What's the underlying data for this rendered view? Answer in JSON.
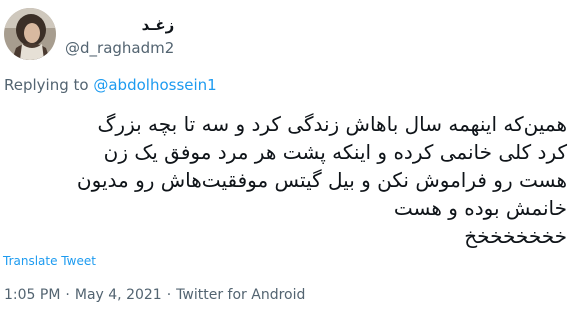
{
  "user": {
    "display_name": "زغـد",
    "handle": "@d_raghadm2",
    "avatar_icon": "profile-photo"
  },
  "reply": {
    "prefix": "Replying to",
    "mention": "@abdolhossein1"
  },
  "tweet": {
    "lines": [
      "همین‌که اینهمه سال باهاش زندگی کرد و سه تا بچه بزرگ",
      "کرد کلی خانمی کرده و اینکه پشت هر مرد موفق یک زن",
      "هست رو فراموش نکن و بیل گیتس موفقیت‌هاش رو مدیون",
      "خانمش بوده و هست",
      "خخخخخخخخ"
    ]
  },
  "translate_label": "Translate Tweet",
  "meta": {
    "time": "1:05 PM",
    "date": "May 4, 2021",
    "source": "Twitter for Android"
  },
  "colors": {
    "link": "#1d9bf0",
    "muted": "#536471",
    "text": "#0f1419"
  }
}
